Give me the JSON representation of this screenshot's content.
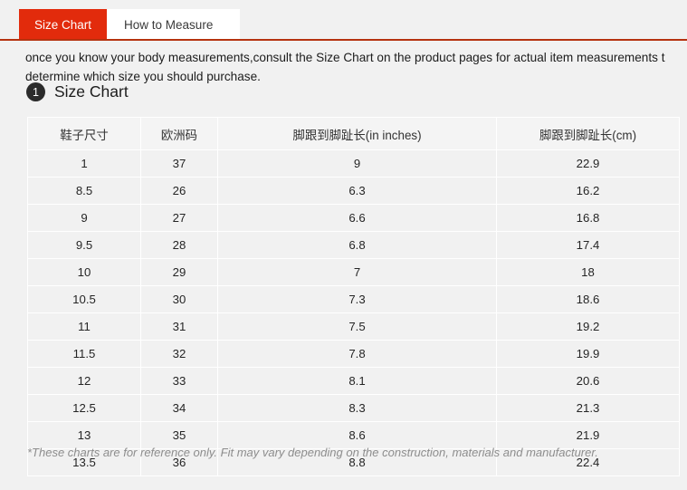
{
  "tabs": [
    {
      "label": "Size Chart",
      "active": true
    },
    {
      "label": "How to Measure",
      "active": false
    }
  ],
  "intro": {
    "line1": "once you know your body measurements,consult the Size Chart on the product pages for actual item measurements t",
    "line2": "determine which size you should purchase."
  },
  "section": {
    "badge": "1",
    "title": "Size Chart"
  },
  "table": {
    "headers": [
      "鞋子尺寸",
      "欧洲码",
      "脚跟到脚趾长(in inches)",
      "脚跟到脚趾长(cm)"
    ],
    "rows": [
      [
        "1",
        "37",
        "9",
        "22.9"
      ],
      [
        "8.5",
        "26",
        "6.3",
        "16.2"
      ],
      [
        "9",
        "27",
        "6.6",
        "16.8"
      ],
      [
        "9.5",
        "28",
        "6.8",
        "17.4"
      ],
      [
        "10",
        "29",
        "7",
        "18"
      ],
      [
        "10.5",
        "30",
        "7.3",
        "18.6"
      ],
      [
        "11",
        "31",
        "7.5",
        "19.2"
      ],
      [
        "11.5",
        "32",
        "7.8",
        "19.9"
      ],
      [
        "12",
        "33",
        "8.1",
        "20.6"
      ],
      [
        "12.5",
        "34",
        "8.3",
        "21.3"
      ],
      [
        "13",
        "35",
        "8.6",
        "21.9"
      ],
      [
        "13.5",
        "36",
        "8.8",
        "22.4"
      ]
    ]
  },
  "footnote": "*These charts are for reference only. Fit may vary depending on the construction, materials and manufacturer.",
  "colors": {
    "accent_red": "#e22b0c",
    "underline_red": "#b5320f",
    "page_bg": "#f1f1f1",
    "badge_bg": "#2b2b2b",
    "footnote_gray": "#8d8d8d"
  }
}
